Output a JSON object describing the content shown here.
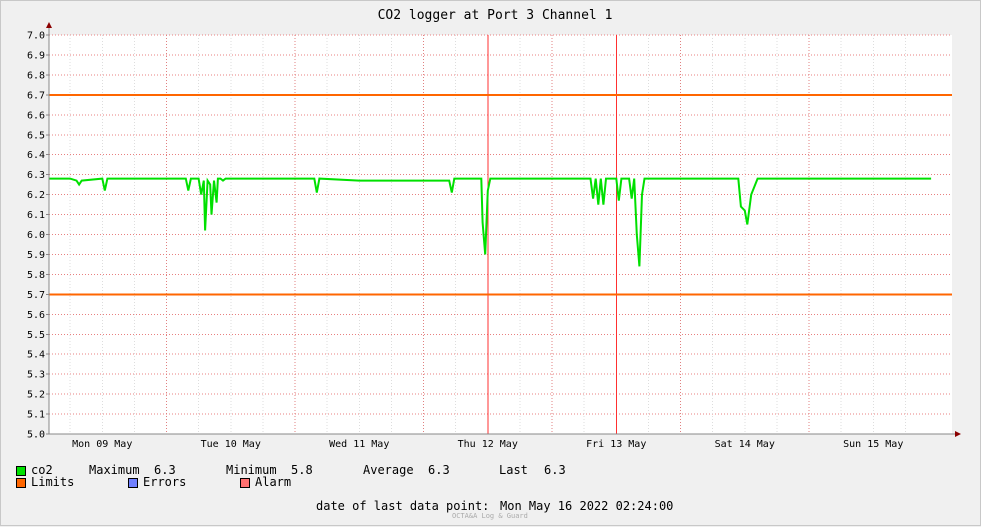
{
  "chart_data": {
    "type": "line",
    "title": "CO2 logger at Port 3 Channel 1",
    "ylim": [
      5.0,
      7.0
    ],
    "y_ticks": [
      "7.0",
      "6.9",
      "6.8",
      "6.7",
      "6.6",
      "6.5",
      "6.4",
      "6.3",
      "6.2",
      "6.1",
      "6.0",
      "5.9",
      "5.8",
      "5.7",
      "5.6",
      "5.5",
      "5.4",
      "5.3",
      "5.2",
      "5.1",
      "5.0"
    ],
    "x_range_days": [
      0,
      7
    ],
    "x_tick_labels": [
      "Mon 09 May",
      "Tue 10 May",
      "Wed 11 May",
      "Thu 12 May",
      "Fri 13 May",
      "Sat 14 May",
      "Sun 15 May"
    ],
    "grid": true,
    "limits": {
      "upper": 6.7,
      "lower": 5.7
    },
    "alarm_days": [
      3.5,
      4.5
    ],
    "series": [
      {
        "name": "co2",
        "baseline": 6.28,
        "x_days": [
          0,
          0.25,
          0.3,
          0.32,
          0.34,
          0.5,
          0.52,
          0.54,
          0.8,
          1.0,
          1.15,
          1.17,
          1.19,
          1.25,
          1.27,
          1.29,
          1.3,
          1.32,
          1.34,
          1.35,
          1.37,
          1.39,
          1.4,
          1.42,
          1.44,
          1.46,
          1.5,
          2.0,
          2.15,
          2.17,
          2.19,
          2.5,
          3.0,
          3.2,
          3.22,
          3.24,
          3.3,
          3.45,
          3.46,
          3.48,
          3.5,
          3.52,
          3.55,
          4.0,
          4.3,
          4.32,
          4.34,
          4.36,
          4.38,
          4.4,
          4.42,
          4.5,
          4.52,
          4.54,
          4.6,
          4.62,
          4.64,
          4.66,
          4.68,
          4.7,
          4.72,
          4.74,
          4.76,
          4.8,
          5.0,
          5.45,
          5.47,
          5.5,
          5.52,
          5.55,
          5.6,
          6.0,
          6.5,
          6.95
        ],
        "values": [
          6.28,
          6.28,
          6.27,
          6.25,
          6.27,
          6.28,
          6.22,
          6.28,
          6.28,
          6.28,
          6.28,
          6.22,
          6.28,
          6.28,
          6.2,
          6.27,
          6.02,
          6.27,
          6.25,
          6.1,
          6.27,
          6.16,
          6.28,
          6.28,
          6.27,
          6.28,
          6.28,
          6.28,
          6.28,
          6.21,
          6.28,
          6.27,
          6.27,
          6.27,
          6.21,
          6.28,
          6.28,
          6.28,
          6.06,
          5.9,
          6.22,
          6.28,
          6.28,
          6.28,
          6.28,
          6.18,
          6.28,
          6.15,
          6.28,
          6.15,
          6.28,
          6.28,
          6.17,
          6.28,
          6.28,
          6.18,
          6.28,
          6.0,
          5.84,
          6.2,
          6.28,
          6.28,
          6.28,
          6.28,
          6.28,
          6.28,
          6.14,
          6.12,
          6.05,
          6.2,
          6.28,
          6.28,
          6.28,
          6.28
        ]
      }
    ]
  },
  "legend": {
    "co2_label": "co2",
    "max_label": "Maximum",
    "max_value": "6.3",
    "min_label": "Minimum",
    "min_value": "5.8",
    "avg_label": "Average",
    "avg_value": "6.3",
    "last_label": "Last",
    "last_value": "6.3",
    "limits_label": "Limits",
    "errors_label": "Errors",
    "alarm_label": "Alarm"
  },
  "colors": {
    "co2": "#00e000",
    "limits": "#ff6600",
    "errors": "#7080ff",
    "alarm": "#ff7070",
    "grid_red": "#e88080",
    "alarm_line": "#ff3030"
  },
  "footer": {
    "label": "date of last data point:",
    "value": "Mon May 16 2022 02:24:00"
  },
  "credit": "OCTA&A Log & Guard"
}
